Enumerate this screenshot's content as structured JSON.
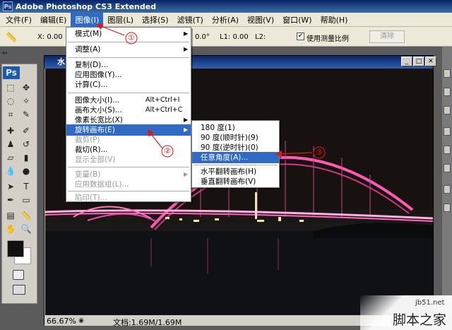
{
  "app": {
    "title": "Adobe Photoshop CS3 Extended",
    "logo": "Ps"
  },
  "menubar": [
    {
      "label": "文件(F)"
    },
    {
      "label": "编辑(E)"
    },
    {
      "label": "图像(I)",
      "active": true
    },
    {
      "label": "图层(L)"
    },
    {
      "label": "选择(S)"
    },
    {
      "label": "滤镜(T)"
    },
    {
      "label": "分析(A)"
    },
    {
      "label": "视图(V)"
    },
    {
      "label": "窗口(W)"
    },
    {
      "label": "帮助(H)"
    }
  ],
  "options": {
    "x_label": "X: 0.00",
    "angle_partial": "0.0°",
    "l1": "L1: 0.00",
    "l2": "L2:",
    "use_scale_label": "使用测量比例",
    "use_scale_checked": true,
    "clear_button": "清除"
  },
  "document": {
    "title_partial": "水",
    "zoom": "66.67%",
    "doc_size": "文档:1.69M/1.69M"
  },
  "image_menu": {
    "items": [
      {
        "label": "模式(M)",
        "arrow": true
      },
      {
        "label": "调整(A)",
        "arrow": true
      },
      {
        "label": "复制(D)..."
      },
      {
        "label": "应用图像(Y)..."
      },
      {
        "label": "计算(C)..."
      },
      {
        "label": "图像大小(I)...",
        "shortcut": "Alt+Ctrl+I"
      },
      {
        "label": "画布大小(S)...",
        "shortcut": "Alt+Ctrl+C"
      },
      {
        "label": "像素长宽比(X)",
        "arrow": true
      },
      {
        "label": "旋转画布(E)",
        "arrow": true,
        "highlighted": true
      },
      {
        "label": "裁剪(P)",
        "disabled": true
      },
      {
        "label": "裁切(R)..."
      },
      {
        "label": "显示全部(V)",
        "disabled": true
      },
      {
        "label": "变量(B)",
        "arrow": true,
        "disabled": true
      },
      {
        "label": "应用数据组(L)...",
        "disabled": true
      },
      {
        "label": "陷印(T)...",
        "disabled": true
      }
    ]
  },
  "rotate_submenu": {
    "items": [
      {
        "label": "180 度(1)"
      },
      {
        "label": "90 度(顺时针)(9)"
      },
      {
        "label": "90 度(逆时针)(0)"
      },
      {
        "label": "任意角度(A)...",
        "highlighted": true
      },
      {
        "label": "水平翻转画布(H)"
      },
      {
        "label": "垂直翻转画布(V)"
      }
    ]
  },
  "annotations": {
    "step1": "①",
    "step2": "②",
    "step3": "③"
  },
  "watermark": {
    "line1": "jb51.net",
    "line2": "脚本之家"
  },
  "colors": {
    "menu_highlight": "#316ac5",
    "annotation_red": "#e01818",
    "bridge_pink": "#ff5ab4"
  }
}
